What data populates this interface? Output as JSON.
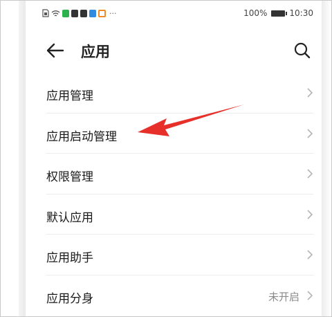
{
  "status_bar": {
    "battery": "100%",
    "time": "10:30",
    "notification_icons": [
      "sim-icon",
      "wifi-icon",
      "app-icon-green",
      "app-icon-dark",
      "app-icon-dark",
      "app-icon-blue",
      "app-icon-orange"
    ],
    "more": "···",
    "colors": {
      "green": "#2bb24c",
      "dark": "#333333",
      "blue": "#2f8ae0",
      "orange": "#f08a24"
    }
  },
  "header": {
    "title": "应用",
    "back_icon": "arrow-left-icon",
    "search_icon": "search-icon"
  },
  "menu": {
    "items": [
      {
        "label": "应用管理",
        "value": ""
      },
      {
        "label": "应用启动管理",
        "value": ""
      },
      {
        "label": "权限管理",
        "value": ""
      },
      {
        "label": "默认应用",
        "value": ""
      },
      {
        "label": "应用助手",
        "value": ""
      },
      {
        "label": "应用分身",
        "value": "未开启"
      }
    ]
  },
  "annotation": {
    "arrow_color": "#e8302a",
    "points_to": "应用启动管理"
  }
}
